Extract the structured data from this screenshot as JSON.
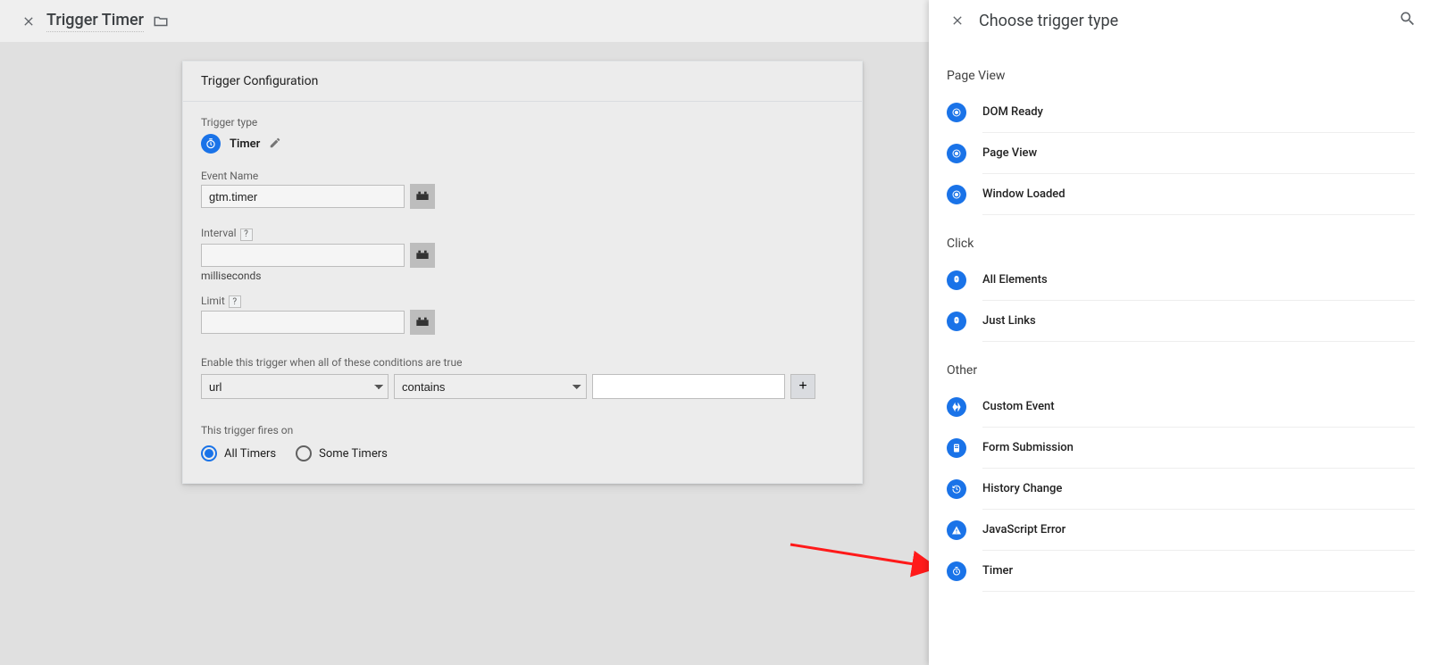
{
  "topbar": {
    "title": "Trigger Timer"
  },
  "card": {
    "header": "Trigger Configuration",
    "triggerTypeLabel": "Trigger type",
    "typeName": "Timer",
    "eventNameLabel": "Event Name",
    "eventNameValue": "gtm.timer",
    "intervalLabel": "Interval",
    "intervalValue": "",
    "intervalUnit": "milliseconds",
    "limitLabel": "Limit",
    "limitValue": "",
    "conditionsLabel": "Enable this trigger when all of these conditions are true",
    "condVar": "url",
    "condOp": "contains",
    "condVal": "",
    "plus": "+",
    "firesOnLabel": "This trigger fires on",
    "radioAll": "All Timers",
    "radioSome": "Some Timers"
  },
  "drawer": {
    "title": "Choose trigger type",
    "groups": [
      {
        "label": "Page View",
        "items": [
          "DOM Ready",
          "Page View",
          "Window Loaded"
        ]
      },
      {
        "label": "Click",
        "items": [
          "All Elements",
          "Just Links"
        ]
      },
      {
        "label": "Other",
        "items": [
          "Custom Event",
          "Form Submission",
          "History Change",
          "JavaScript Error",
          "Timer"
        ]
      }
    ]
  }
}
